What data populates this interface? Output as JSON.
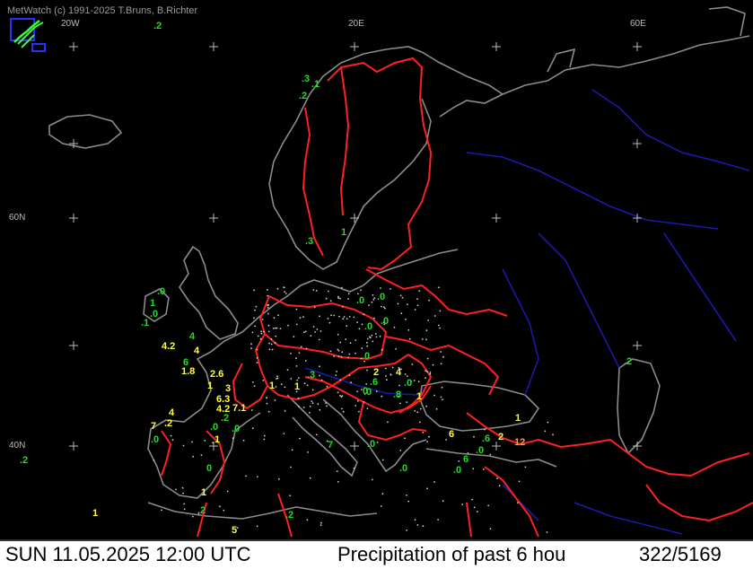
{
  "credit": "MetWatch  (c) 1991-2025 T.Bruns, B.Richter",
  "grid_labels": {
    "lon_20w": "20W",
    "lon_20e": "20E",
    "lon_60e": "60E",
    "lat_60n": "60N",
    "lat_40n": "40N"
  },
  "status": {
    "datetime": "SUN 11.05.2025 12:00 UTC",
    "title": "Precipitation of past  6 hou",
    "counts": "322/5169"
  },
  "colors": {
    "background": "#000000",
    "coastline": "#8c8c8c",
    "borders": "#ff2020",
    "rivers": "#1a1aa8",
    "value_green": "#22dd22",
    "value_yellow": "#ffff33",
    "value_orange": "#ff9933"
  },
  "observations": [
    {
      "v": ".2",
      "c": "green"
    },
    {
      "v": ".1",
      "c": "green"
    },
    {
      "v": ".2",
      "c": "green"
    },
    {
      "v": ".3",
      "c": "green"
    },
    {
      "v": "1",
      "c": "green"
    },
    {
      "v": ".0",
      "c": "green"
    },
    {
      "v": "1",
      "c": "green"
    },
    {
      "v": ".0",
      "c": "green"
    },
    {
      "v": ".1",
      "c": "green"
    },
    {
      "v": ".0",
      "c": "green"
    },
    {
      "v": ".0",
      "c": "green"
    },
    {
      "v": ".0",
      "c": "green"
    },
    {
      "v": ".0",
      "c": "green"
    },
    {
      "v": "4",
      "c": "green"
    },
    {
      "v": "4.2",
      "c": "yellow"
    },
    {
      "v": "4",
      "c": "yellow"
    },
    {
      "v": "6",
      "c": "green"
    },
    {
      "v": "1.8",
      "c": "yellow"
    },
    {
      "v": "2.6",
      "c": "yellow"
    },
    {
      "v": "1",
      "c": "yellow"
    },
    {
      "v": "3",
      "c": "yellow"
    },
    {
      "v": "6.3",
      "c": "yellow"
    },
    {
      "v": "4.2",
      "c": "yellow"
    },
    {
      "v": "7.1",
      "c": "yellow"
    },
    {
      "v": ".2",
      "c": "green"
    },
    {
      "v": ".0",
      "c": "green"
    },
    {
      "v": ".0",
      "c": "green"
    },
    {
      "v": ".3",
      "c": "green"
    },
    {
      "v": ".0",
      "c": "green"
    },
    {
      "v": "1",
      "c": "yellow"
    },
    {
      "v": "1",
      "c": "yellow"
    },
    {
      "v": ".0",
      "c": "green"
    },
    {
      "v": "2",
      "c": "yellow"
    },
    {
      "v": "4",
      "c": "yellow"
    },
    {
      "v": ".6",
      "c": "green"
    },
    {
      "v": ".0",
      "c": "green"
    },
    {
      "v": "0",
      "c": "green"
    },
    {
      "v": ".8",
      "c": "green"
    },
    {
      "v": "1",
      "c": "yellow"
    },
    {
      "v": "4",
      "c": "yellow"
    },
    {
      "v": "7",
      "c": "yellow"
    },
    {
      "v": ".2",
      "c": "yellow"
    },
    {
      "v": ".0",
      "c": "green"
    },
    {
      "v": ".0",
      "c": "green"
    },
    {
      "v": ".0",
      "c": "green"
    },
    {
      "v": "1",
      "c": "yellow"
    },
    {
      "v": ".3",
      "c": "green"
    },
    {
      "v": "7",
      "c": "green"
    },
    {
      "v": ".0",
      "c": "green"
    },
    {
      "v": "6",
      "c": "yellow"
    },
    {
      "v": ".6",
      "c": "green"
    },
    {
      "v": "2",
      "c": "yellow"
    },
    {
      "v": "1",
      "c": "yellow"
    },
    {
      "v": "12",
      "c": "orange"
    },
    {
      "v": "6",
      "c": "green"
    },
    {
      "v": ".0",
      "c": "green"
    },
    {
      "v": "0",
      "c": "green"
    },
    {
      "v": ".2",
      "c": "green"
    },
    {
      "v": "1",
      "c": "yellow"
    },
    {
      "v": "1",
      "c": "yellow"
    },
    {
      "v": "5",
      "c": "yellow"
    },
    {
      "v": ".2",
      "c": "green"
    },
    {
      "v": ".2",
      "c": "green"
    },
    {
      "v": ".2",
      "c": "green"
    }
  ]
}
